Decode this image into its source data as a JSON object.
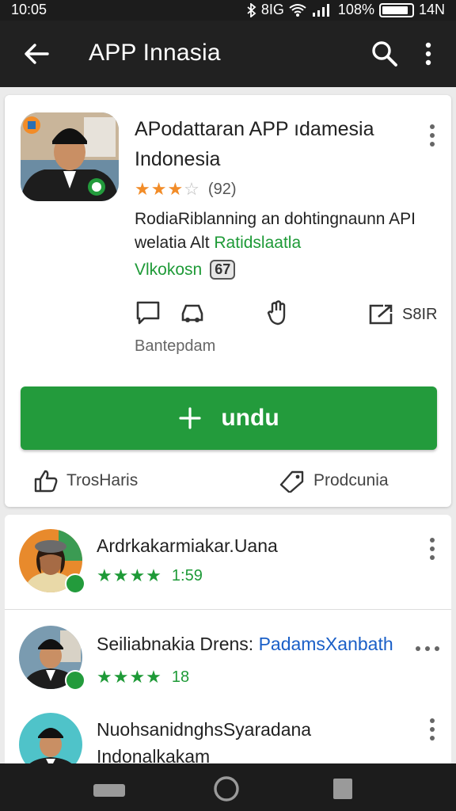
{
  "status_bar": {
    "time": "10:05",
    "network": "8IG",
    "battery": "108%",
    "extra": "14N"
  },
  "app_bar": {
    "title": "APP Innasia"
  },
  "app_card": {
    "name": "APodattaran APP ıdamesia Indonesia",
    "rating_stars": "★★★",
    "rating_half": "☆",
    "rating_count": "(92)",
    "desc_line1": "RodiaRiblanning an dohtingnaunn API",
    "desc_line2_a": "welatia Alt ",
    "desc_line2_b": "Ratidslaatla",
    "version_label": "Vlkokosn",
    "version_badge": "67",
    "share_label": "S8IR",
    "category": "Bantepdam",
    "install_label": "undu",
    "action_left": "TrosHaris",
    "action_right": "Prodcunia"
  },
  "list": [
    {
      "title": "Ardrkakarmiakar.Uana",
      "stars": "★★★★",
      "value": "1:59"
    },
    {
      "title": "Seiliabnakia Drens: ",
      "link": "PadamsXanbath",
      "stars": "★★★★",
      "value": "18"
    },
    {
      "title_line1": "NuohsanidnghsSyaradana",
      "title_line2": "Indonalkakam"
    }
  ],
  "colors": {
    "accent_green": "#239b3c",
    "star_orange": "#f28c28",
    "link_blue": "#1a5fc7"
  }
}
